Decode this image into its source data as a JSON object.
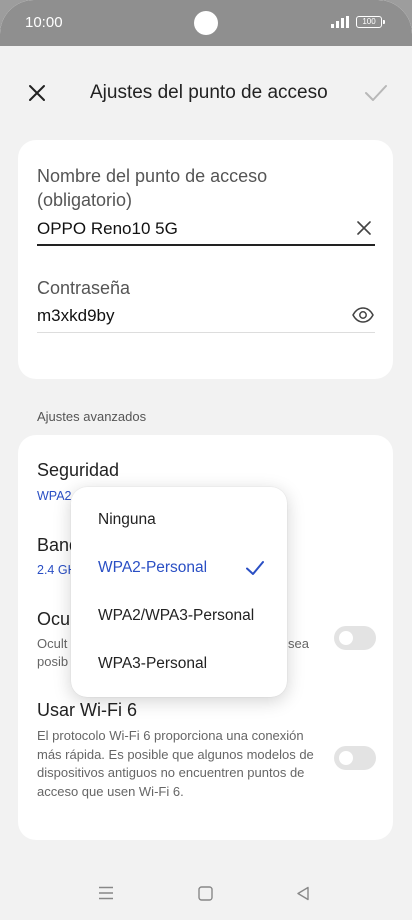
{
  "status_bar": {
    "time": "10:00",
    "battery": "100"
  },
  "header": {
    "title": "Ajustes del punto de acceso",
    "close_icon": "close-icon",
    "confirm_icon": "checkmark-icon"
  },
  "hotspot": {
    "name_label_line1": "Nombre del punto de acceso",
    "name_label_line2": "(obligatorio)",
    "name_value": "OPPO Reno10 5G",
    "password_label": "Contraseña",
    "password_value": "m3xkd9by"
  },
  "advanced": {
    "section_title": "Ajustes avanzados",
    "security_title": "Seguridad",
    "security_value_partial": "WPA2",
    "band_title_partial": "Banda",
    "band_value_partial": "2.4 GHz",
    "hide_title_partial": "Ocul",
    "hide_desc_partial_line1": "Ocult",
    "hide_desc_partial_line1_end": "sea",
    "hide_desc_partial_line2": "posib",
    "wifi6_title": "Usar Wi-Fi 6",
    "wifi6_desc": "El protocolo Wi-Fi 6 proporciona una conexión más rápida. Es posible que algunos modelos de dispositivos antiguos no encuentren puntos de acceso que usen Wi-Fi 6.",
    "hide_toggle_on": false,
    "wifi6_toggle_on": false
  },
  "dropdown": {
    "options": [
      {
        "label": "Ninguna",
        "selected": false
      },
      {
        "label": "WPA2-Personal",
        "selected": true
      },
      {
        "label": "WPA2/WPA3-Personal",
        "selected": false
      },
      {
        "label": "WPA3-Personal",
        "selected": false
      }
    ]
  },
  "colors": {
    "accent": "#2a4fc4",
    "background": "#f2f2f2",
    "card": "#ffffff",
    "status_bar": "#8f8f8f"
  }
}
